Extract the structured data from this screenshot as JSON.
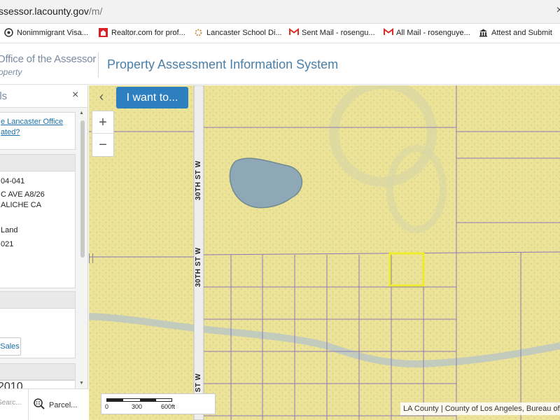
{
  "browser": {
    "url_main": "ssessor.lacounty.gov",
    "url_path": "/m/",
    "bookmarks": [
      {
        "label": "Nonimmigrant Visa...",
        "icon": "seal-icon"
      },
      {
        "label": "Realtor.com for prof...",
        "icon": "realtor-icon"
      },
      {
        "label": "Lancaster School Di...",
        "icon": "school-icon"
      },
      {
        "label": "Sent Mail - rosengu...",
        "icon": "gmail-icon"
      },
      {
        "label": "All Mail - rosenguye...",
        "icon": "gmail-icon"
      },
      {
        "label": "Attest and Submit",
        "icon": "bank-icon"
      }
    ]
  },
  "header": {
    "brand_line1": "Office of the Assessor",
    "brand_line2": "operty",
    "system_title": "Property Assessment Information System"
  },
  "panel": {
    "title": "ils",
    "close": "×",
    "office_link": "e Lancaster Office\nated?",
    "details": {
      "apn": "04-041",
      "address1": "C AVE A8/26",
      "address2": "ALICHE CA",
      "use": "Land",
      "year": "021"
    },
    "sales_button": "Sales",
    "lower_value": "2010",
    "search_tab": "Searc...",
    "parcel_tab": "Parcel..."
  },
  "map": {
    "collapse": "‹",
    "i_want_to": "I want to...",
    "zoom_in": "+",
    "zoom_out": "−",
    "street_label": "30TH ST W",
    "scale": {
      "zero": "0",
      "mid": "300",
      "end": "600ft"
    },
    "attribution": "LA County | County of Los Angeles, Bureau of"
  },
  "colors": {
    "map_base": "#efe69a",
    "parcel_line": "#8d78b8",
    "highlight": "#ecec2a",
    "accent": "#2e7fc0",
    "water": "#8ea8b8"
  }
}
